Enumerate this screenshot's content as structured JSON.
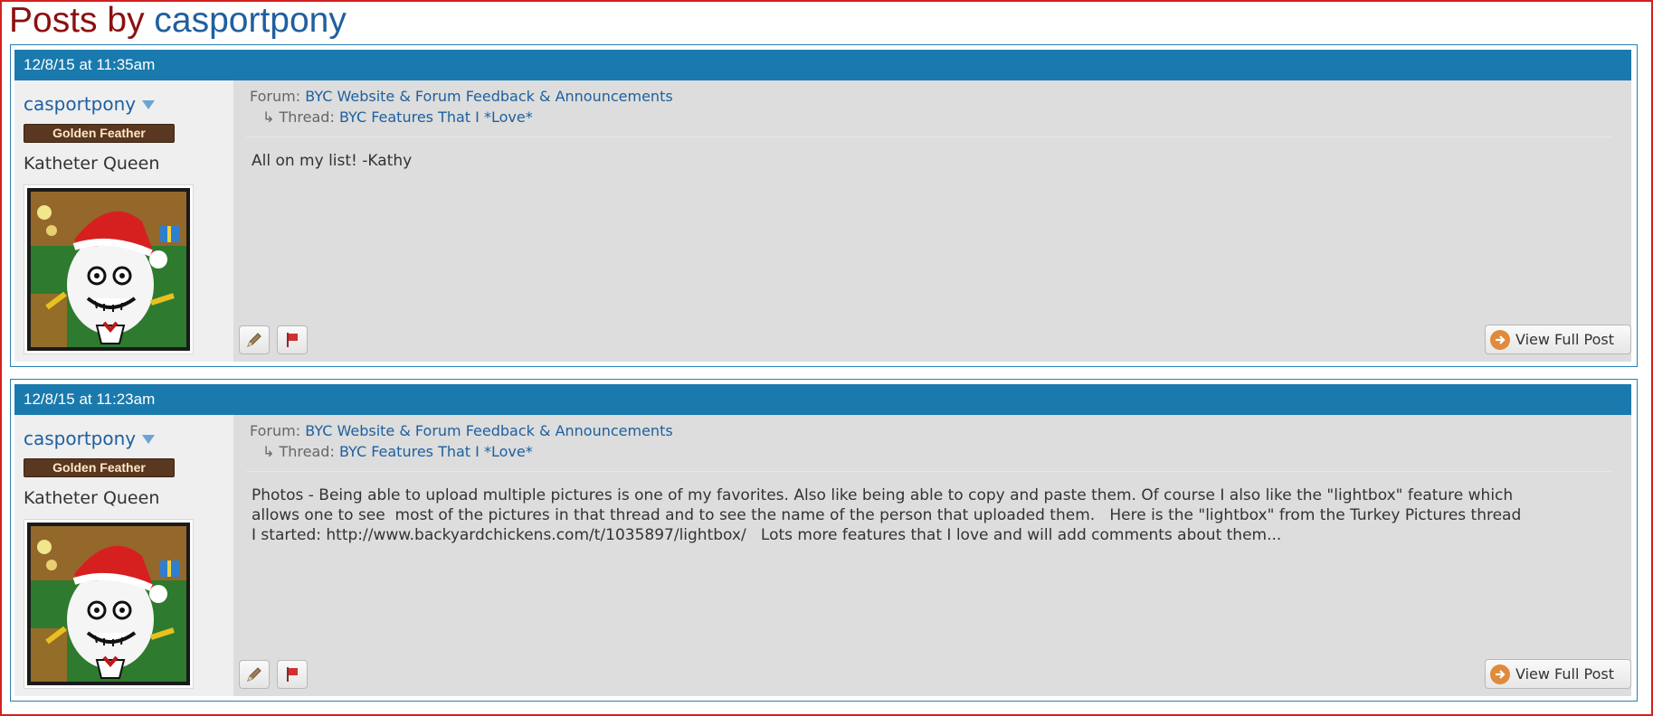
{
  "page": {
    "title_prefix": "Posts by ",
    "title_user": "casportpony"
  },
  "posts": [
    {
      "timestamp": "12/8/15 at 11:35am",
      "author": {
        "username": "casportpony",
        "badge": "Golden Feather",
        "title": "Katheter Queen"
      },
      "forum_label": "Forum:",
      "forum": "BYC Website & Forum Feedback & Announcements",
      "thread_arrow": "↳",
      "thread_label": "Thread:",
      "thread": "BYC Features That I *Love*",
      "text": "All on my list! -Kathy",
      "view_full_label": "View Full Post"
    },
    {
      "timestamp": "12/8/15 at 11:23am",
      "author": {
        "username": "casportpony",
        "badge": "Golden Feather",
        "title": "Katheter Queen"
      },
      "forum_label": "Forum:",
      "forum": "BYC Website & Forum Feedback & Announcements",
      "thread_arrow": "↳",
      "thread_label": "Thread:",
      "thread": "BYC Features That I *Love*",
      "text": "Photos - Being able to upload multiple pictures is one of my favorites. Also like being able to copy and paste them. Of course I also like the \"lightbox\" feature which\nallows one to see  most of the pictures in that thread and to see the name of the person that uploaded them.   Here is the \"lightbox\" from the Turkey Pictures thread\nI started: http://www.backyardchickens.com/t/1035897/lightbox/   Lots more features that I love and will add comments about them...",
      "view_full_label": "View Full Post"
    }
  ],
  "colors": {
    "header_bar": "#1a7aad",
    "link": "#1f5fa0",
    "title_dark_red": "#8b1010",
    "badge_bg": "#5a3720",
    "body_bg": "#dcdddc"
  },
  "icons": {
    "edit": "pencil-icon",
    "flag": "flag-icon",
    "view": "arrow-circle-icon",
    "menu": "caret-down-icon",
    "avatar": "avatar-image"
  }
}
